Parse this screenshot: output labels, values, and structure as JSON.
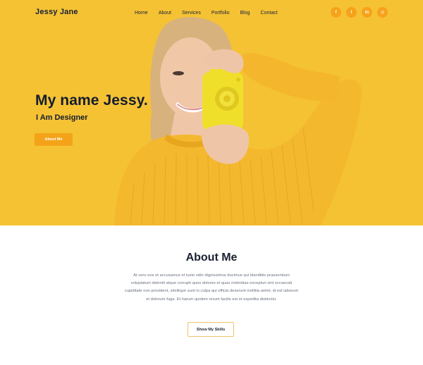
{
  "nav": {
    "brand": "Jessy Jane",
    "links": [
      {
        "label": "Home"
      },
      {
        "label": "About"
      },
      {
        "label": "Services"
      },
      {
        "label": "Portfolio"
      },
      {
        "label": "Blog"
      },
      {
        "label": "Contact"
      }
    ],
    "socials": [
      {
        "icon": "facebook-icon",
        "glyph": "f"
      },
      {
        "icon": "twitter-icon",
        "glyph": "t"
      },
      {
        "icon": "linkedin-icon",
        "glyph": "in"
      },
      {
        "icon": "instagram-icon",
        "glyph": "◎"
      }
    ]
  },
  "hero": {
    "title": "My name Jessy.",
    "subtitle": "I Am Designer",
    "cta_label": "About Me",
    "background_color": "#f5c233",
    "accent_color": "#f4a318"
  },
  "about": {
    "title": "About Me",
    "text": "At vero eos et accusamus et iusto odio dignissimos ducimus qui blanditiis praesentium voluptatum deleniti atque corrupti quos dolores et quas molestias excepturi sint occaecati cupiditate non provident, similique sunt in culpa qui officia deserunt mollitia animi, id est laborum et dolorum fuga. Et harum quidem rerum facilis est et expedita distinctio.",
    "button_label": "Show My Skills"
  }
}
